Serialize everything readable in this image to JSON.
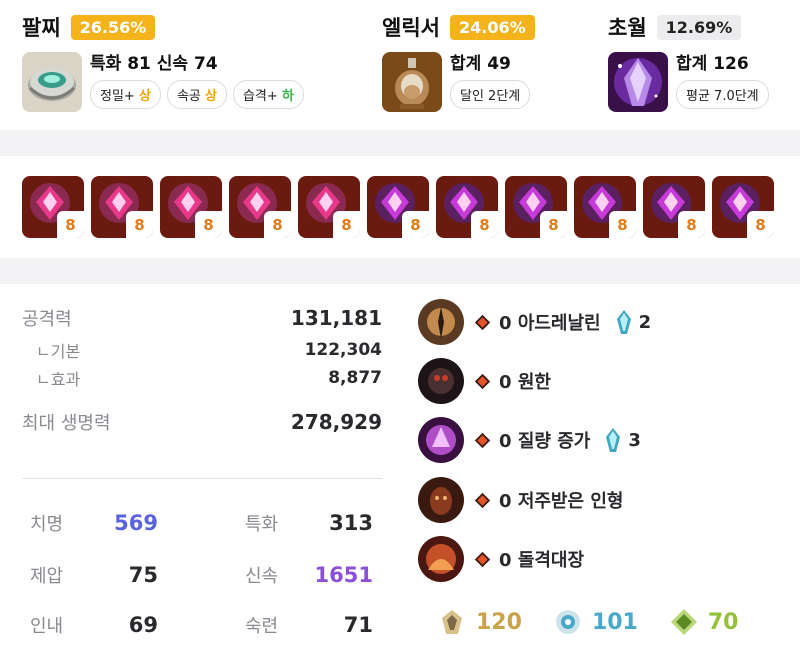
{
  "sections": [
    {
      "name": "팔찌",
      "percent": "26.56%",
      "line": "특화 81 신속 74",
      "chips": [
        {
          "label": "정밀+",
          "grade": "상"
        },
        {
          "label": "속공",
          "grade": "상"
        },
        {
          "label": "습격+",
          "grade": "하"
        }
      ]
    },
    {
      "name": "엘릭서",
      "percent": "24.06%",
      "line": "합계 49",
      "chip": "달인 2단계"
    },
    {
      "name": "초월",
      "percent": "12.69%",
      "line": "합계 126",
      "chip": "평균 7.0단계"
    }
  ],
  "gems": [
    {
      "level": "8",
      "kind": "damage"
    },
    {
      "level": "8",
      "kind": "damage"
    },
    {
      "level": "8",
      "kind": "damage"
    },
    {
      "level": "8",
      "kind": "damage"
    },
    {
      "level": "8",
      "kind": "damage"
    },
    {
      "level": "8",
      "kind": "cooldown"
    },
    {
      "level": "8",
      "kind": "cooldown"
    },
    {
      "level": "8",
      "kind": "cooldown"
    },
    {
      "level": "8",
      "kind": "cooldown"
    },
    {
      "level": "8",
      "kind": "cooldown"
    },
    {
      "level": "8",
      "kind": "cooldown"
    }
  ],
  "stats": {
    "attack_label": "공격력",
    "attack_value": "131,181",
    "base_label": "ㄴ기본",
    "base_value": "122,304",
    "effect_label": "ㄴ효과",
    "effect_value": "8,877",
    "hp_label": "최대 생명력",
    "hp_value": "278,929"
  },
  "combat_stats": [
    {
      "label": "치명",
      "value": "569"
    },
    {
      "label": "특화",
      "value": "313"
    },
    {
      "label": "제압",
      "value": "75"
    },
    {
      "label": "신속",
      "value": "1651"
    },
    {
      "label": "인내",
      "value": "69"
    },
    {
      "label": "숙련",
      "value": "71"
    }
  ],
  "engravings": [
    {
      "level": "0",
      "name": "아드레날린",
      "stone": "2"
    },
    {
      "level": "0",
      "name": "원한",
      "stone": ""
    },
    {
      "level": "0",
      "name": "질량 증가",
      "stone": "3"
    },
    {
      "level": "0",
      "name": "저주받은 인형",
      "stone": ""
    },
    {
      "level": "0",
      "name": "돌격대장",
      "stone": ""
    }
  ],
  "ark": [
    {
      "icon": "evolution-icon",
      "value": "120",
      "color": "#c9a24a"
    },
    {
      "icon": "enlightenment-icon",
      "value": "101",
      "color": "#4aa8c9"
    },
    {
      "icon": "leap-icon",
      "value": "70",
      "color": "#93c23a"
    }
  ]
}
